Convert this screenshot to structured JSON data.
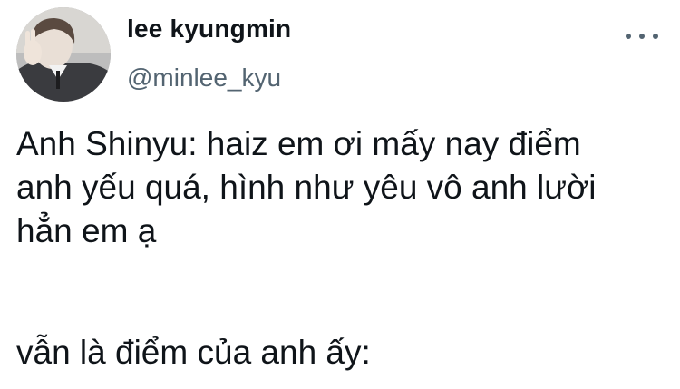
{
  "author": {
    "display_name": "lee kyungmin",
    "handle": "@minlee_kyu"
  },
  "tweet": {
    "paragraph_1": "Anh Shinyu: haiz em ơi mấy nay điểm\nanh yếu quá, hình như yêu vô anh lười\nhẳn em ạ",
    "paragraph_2": "vẫn là điểm của anh ấy:"
  },
  "icons": {
    "more": "more-horizontal-icon"
  },
  "colors": {
    "text": "#0f1419",
    "secondary": "#536471",
    "background": "#ffffff"
  }
}
